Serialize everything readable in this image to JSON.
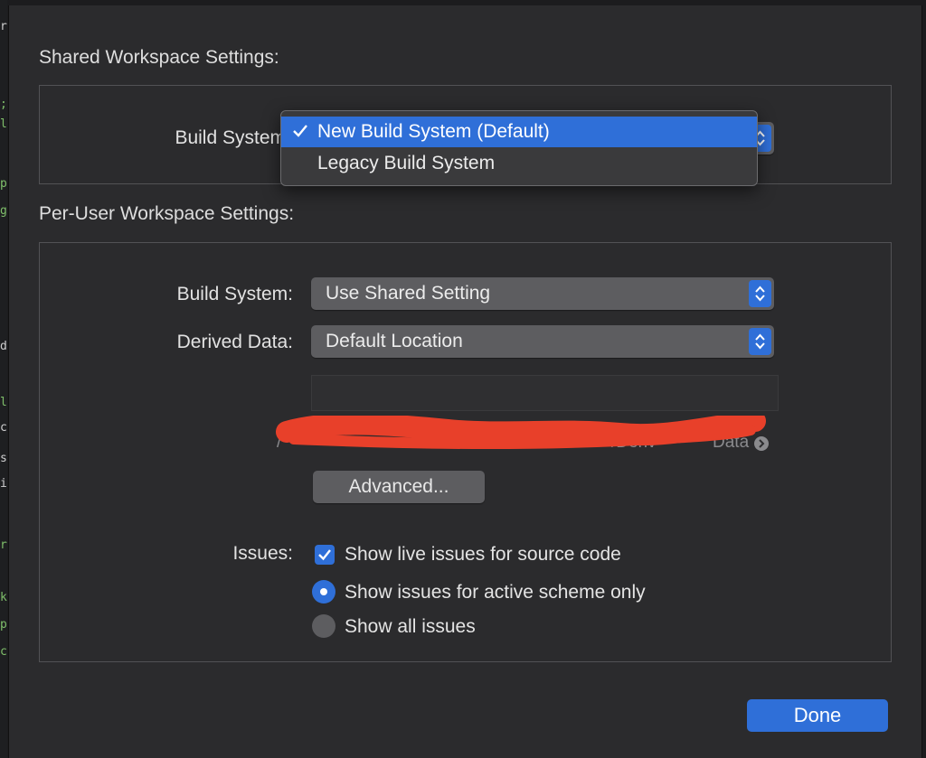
{
  "shared": {
    "title": "Shared Workspace Settings:",
    "build_system_label": "Build System",
    "build_system_value": "New Build System (Default)",
    "menu": {
      "items": [
        {
          "label": "New Build System (Default)",
          "selected": true
        },
        {
          "label": "Legacy Build System",
          "selected": false
        }
      ]
    }
  },
  "per_user": {
    "title": "Per-User Workspace Settings:",
    "build_system_label": "Build System:",
    "build_system_value": "Use Shared Setting",
    "derived_data_label": "Derived Data:",
    "derived_data_value": "Default Location",
    "path_prefix": "/",
    "path_fragment_mid": "/Deriv",
    "path_fragment_end": "Data",
    "advanced_button": "Advanced...",
    "issues_label": "Issues:",
    "issues": {
      "live_issues": {
        "label": "Show live issues for source code",
        "checked": true
      },
      "active_scheme": {
        "label": "Show issues for active scheme only",
        "selected": true
      },
      "all_issues": {
        "label": "Show all issues",
        "selected": false
      }
    }
  },
  "done_button": "Done",
  "colors": {
    "accent": "#2f6fd8",
    "sheet_bg": "#2b2b2d",
    "control_bg": "#5d5d60",
    "redaction": "#e8402a"
  }
}
